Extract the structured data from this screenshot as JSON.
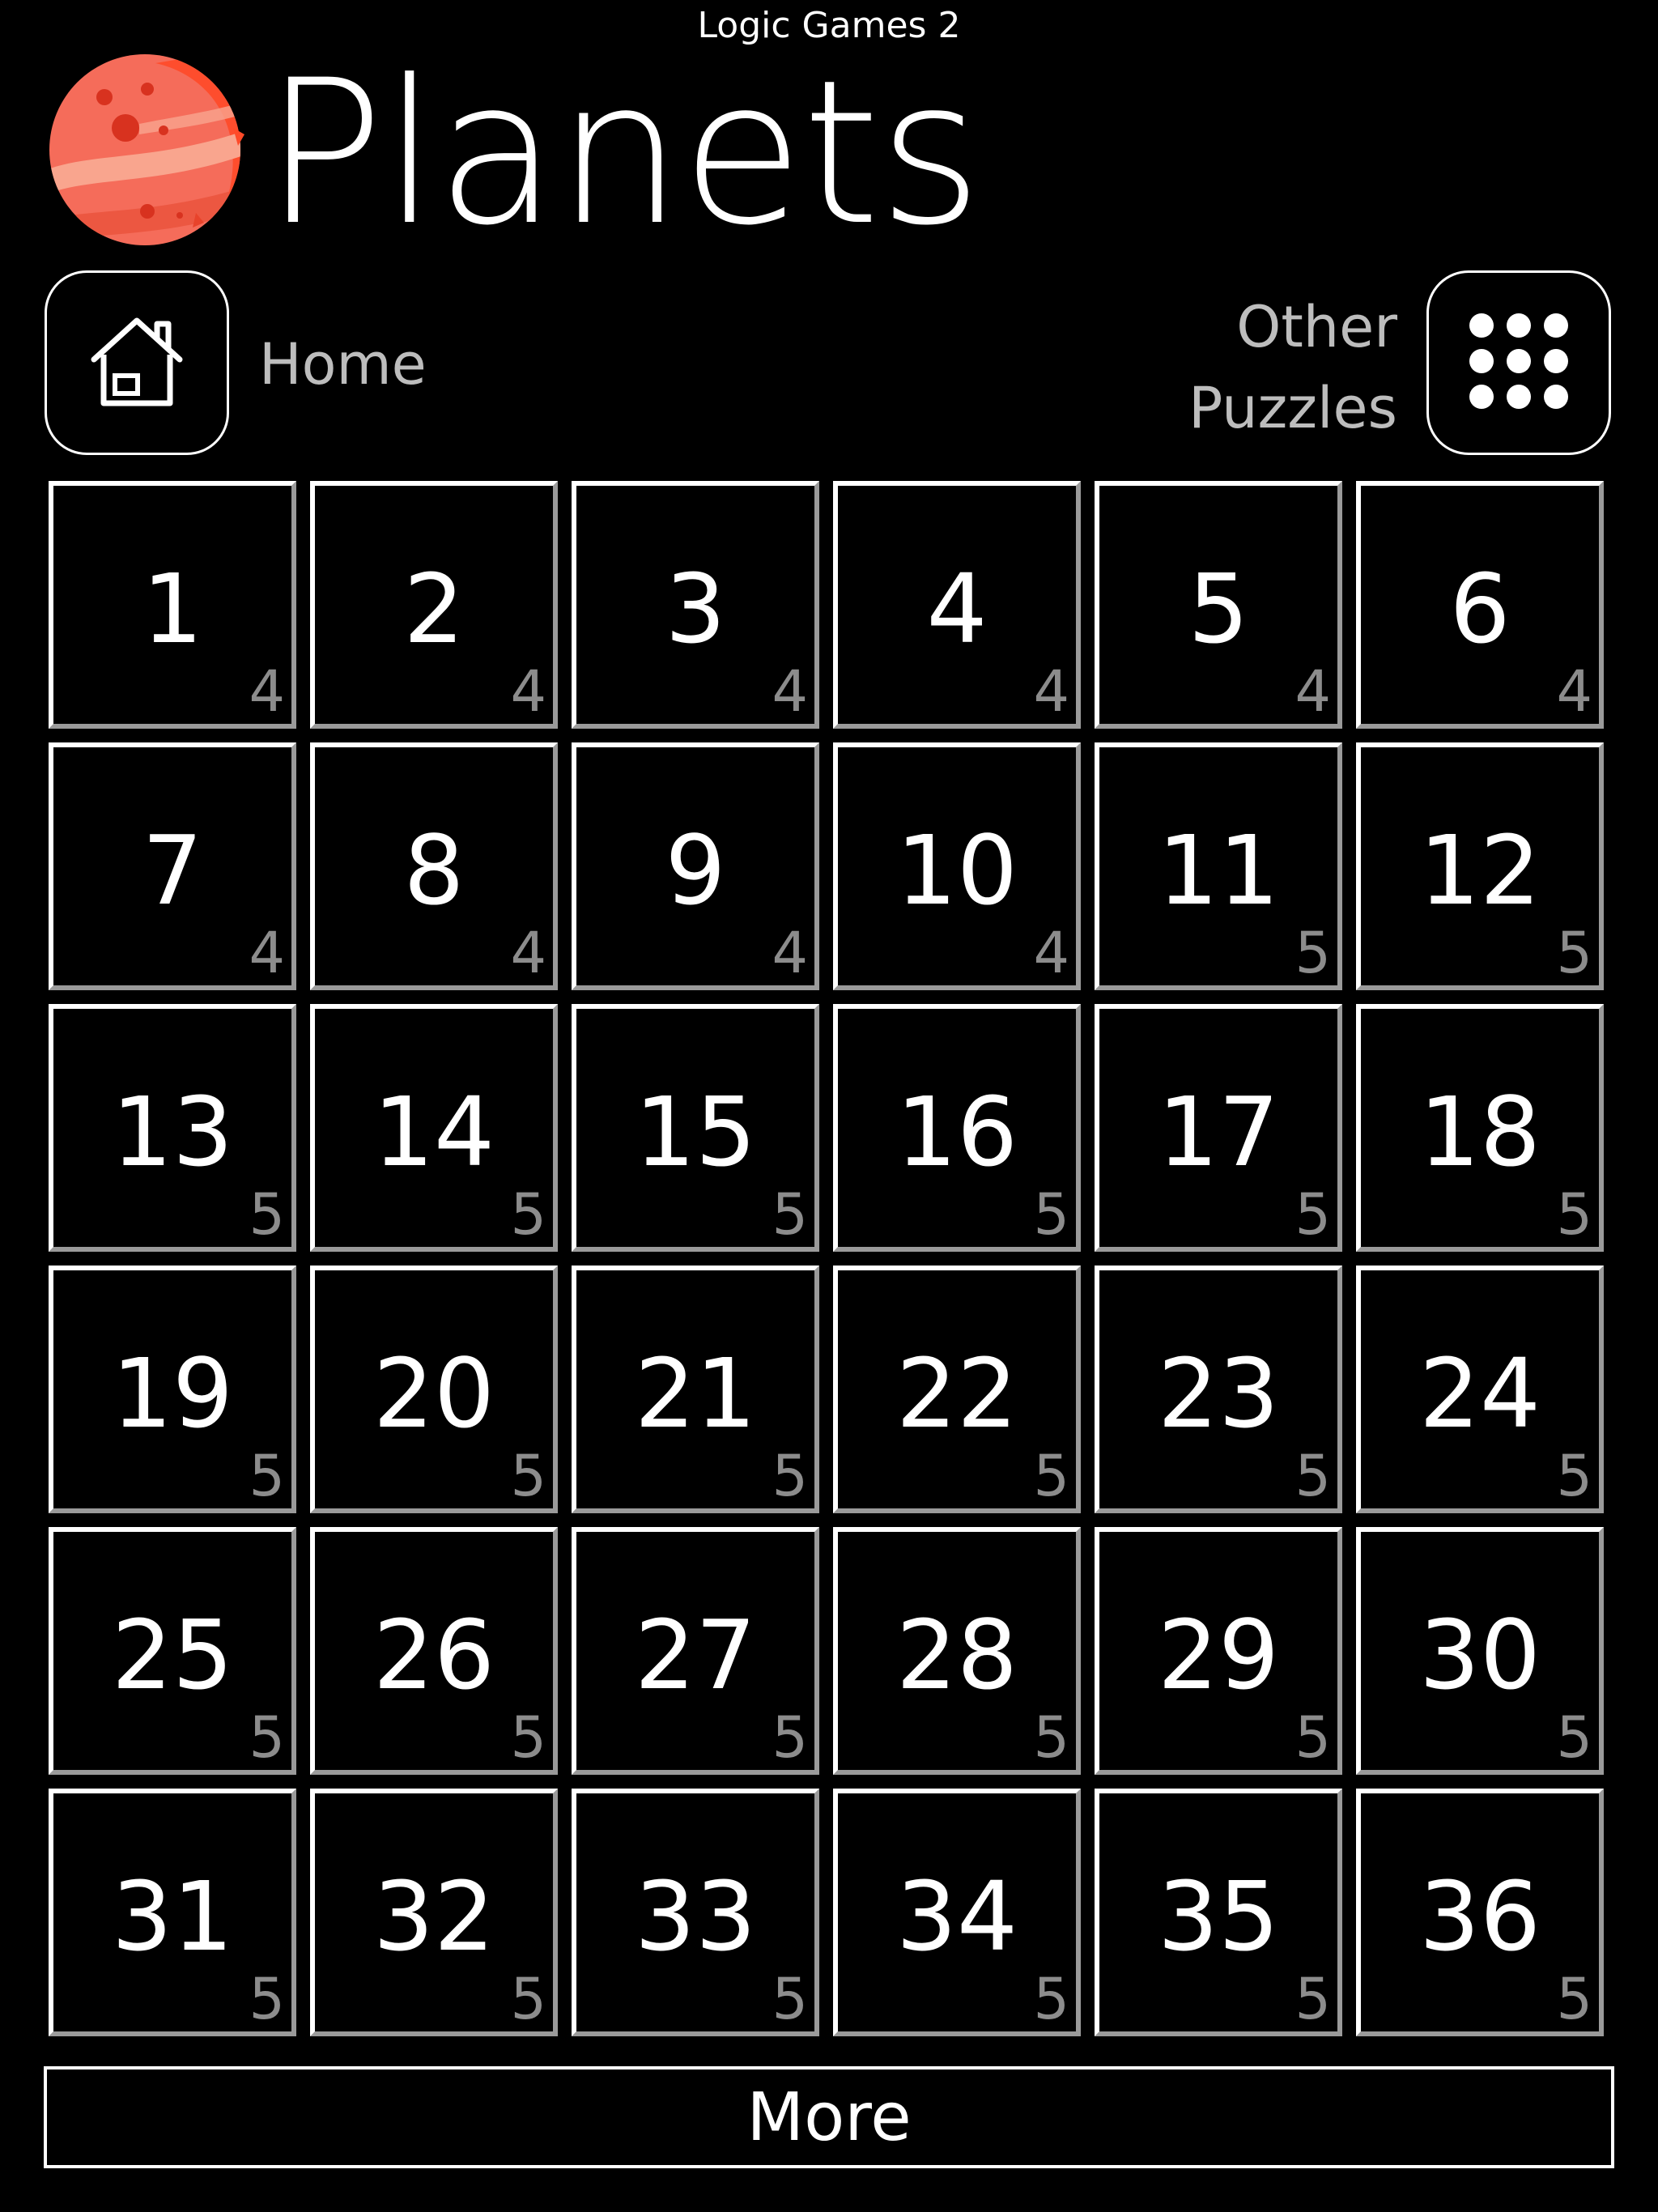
{
  "app": {
    "title": "Logic Games 2"
  },
  "header": {
    "title": "Planets",
    "logo_icon": "red-planet-icon"
  },
  "nav": {
    "home_label": "Home",
    "home_icon": "house-icon",
    "other_puzzles_line1": "Other",
    "other_puzzles_line2": "Puzzles",
    "other_puzzles_icon": "grid-dots-icon"
  },
  "levels": [
    {
      "number": "1",
      "sub": "4"
    },
    {
      "number": "2",
      "sub": "4"
    },
    {
      "number": "3",
      "sub": "4"
    },
    {
      "number": "4",
      "sub": "4"
    },
    {
      "number": "5",
      "sub": "4"
    },
    {
      "number": "6",
      "sub": "4"
    },
    {
      "number": "7",
      "sub": "4"
    },
    {
      "number": "8",
      "sub": "4"
    },
    {
      "number": "9",
      "sub": "4"
    },
    {
      "number": "10",
      "sub": "4"
    },
    {
      "number": "11",
      "sub": "5"
    },
    {
      "number": "12",
      "sub": "5"
    },
    {
      "number": "13",
      "sub": "5"
    },
    {
      "number": "14",
      "sub": "5"
    },
    {
      "number": "15",
      "sub": "5"
    },
    {
      "number": "16",
      "sub": "5"
    },
    {
      "number": "17",
      "sub": "5"
    },
    {
      "number": "18",
      "sub": "5"
    },
    {
      "number": "19",
      "sub": "5"
    },
    {
      "number": "20",
      "sub": "5"
    },
    {
      "number": "21",
      "sub": "5"
    },
    {
      "number": "22",
      "sub": "5"
    },
    {
      "number": "23",
      "sub": "5"
    },
    {
      "number": "24",
      "sub": "5"
    },
    {
      "number": "25",
      "sub": "5"
    },
    {
      "number": "26",
      "sub": "5"
    },
    {
      "number": "27",
      "sub": "5"
    },
    {
      "number": "28",
      "sub": "5"
    },
    {
      "number": "29",
      "sub": "5"
    },
    {
      "number": "30",
      "sub": "5"
    },
    {
      "number": "31",
      "sub": "5"
    },
    {
      "number": "32",
      "sub": "5"
    },
    {
      "number": "33",
      "sub": "5"
    },
    {
      "number": "34",
      "sub": "5"
    },
    {
      "number": "35",
      "sub": "5"
    },
    {
      "number": "36",
      "sub": "5"
    }
  ],
  "footer": {
    "more_label": "More"
  },
  "colors": {
    "background": "#000000",
    "foreground": "#ffffff",
    "muted": "#8c8c8c",
    "planet": "#f46a55"
  }
}
